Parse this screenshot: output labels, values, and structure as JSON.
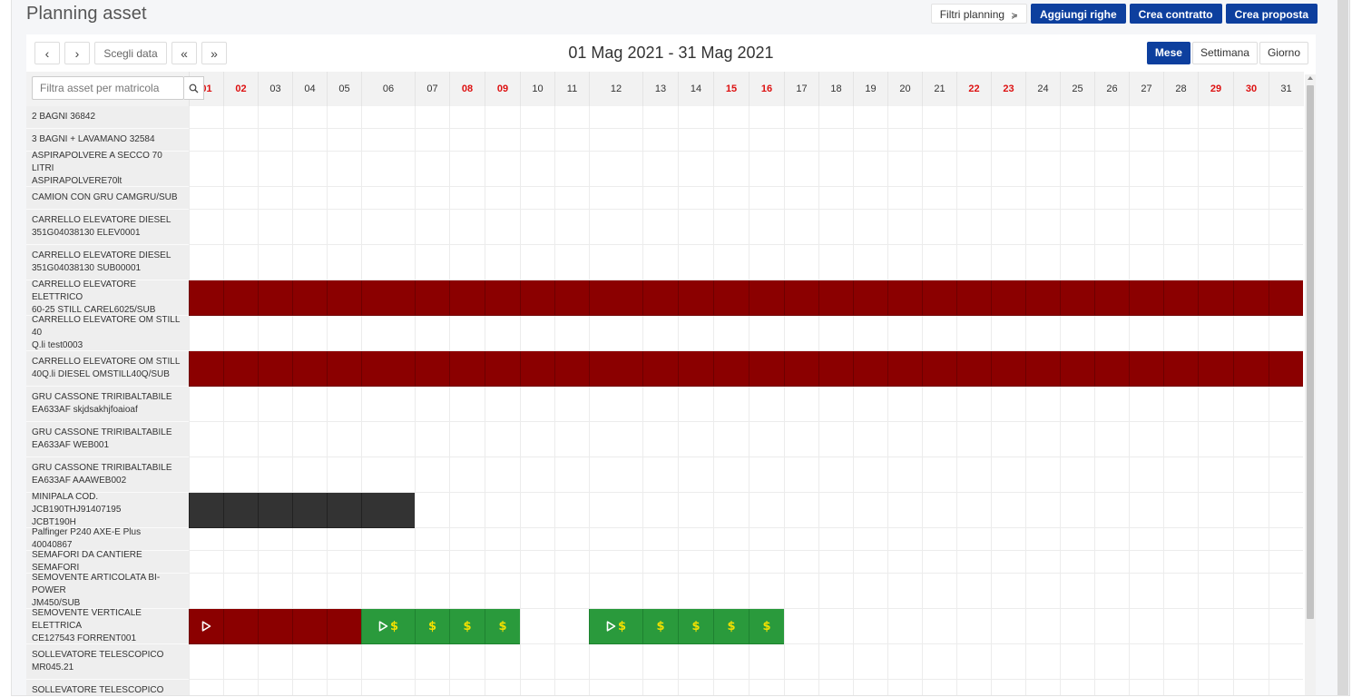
{
  "page": {
    "title": "Planning asset"
  },
  "top_actions": [
    {
      "name": "filter-planning-button",
      "label": "Filtri planning",
      "icon": "chevron-double-down-icon",
      "style": "default"
    },
    {
      "name": "add-rows-button",
      "label": "Aggiungi righe",
      "style": "primary"
    },
    {
      "name": "create-contract-button",
      "label": "Crea contratto",
      "style": "primary"
    },
    {
      "name": "create-proposal-button",
      "label": "Crea proposta",
      "style": "primary"
    }
  ],
  "toolbar": {
    "prev": "‹",
    "next": "›",
    "choose_date": "Scegli data",
    "fast_prev": "«",
    "fast_next": "»",
    "range_title": "01 Mag 2021 - 31 Mag 2021",
    "views": [
      "Mese",
      "Settimana",
      "Giorno"
    ],
    "active_view": "Mese"
  },
  "filter": {
    "placeholder": "Filtra asset per matricola",
    "icon": "search-icon"
  },
  "colors": {
    "primary": "#0d3f9e",
    "booked": "#8b0000",
    "blocked": "#333333",
    "contract": "#2a9a3c",
    "weekend_text": "#dd1111"
  },
  "days": [
    {
      "label": "01",
      "weekend": true
    },
    {
      "label": "02",
      "weekend": true
    },
    {
      "label": "03",
      "weekend": false
    },
    {
      "label": "04",
      "weekend": false
    },
    {
      "label": "05",
      "weekend": false
    },
    {
      "label": "06",
      "weekend": false
    },
    {
      "label": "07",
      "weekend": false
    },
    {
      "label": "08",
      "weekend": true
    },
    {
      "label": "09",
      "weekend": true
    },
    {
      "label": "10",
      "weekend": false
    },
    {
      "label": "11",
      "weekend": false
    },
    {
      "label": "12",
      "weekend": false
    },
    {
      "label": "13",
      "weekend": false
    },
    {
      "label": "14",
      "weekend": false
    },
    {
      "label": "15",
      "weekend": true
    },
    {
      "label": "16",
      "weekend": true
    },
    {
      "label": "17",
      "weekend": false
    },
    {
      "label": "18",
      "weekend": false
    },
    {
      "label": "19",
      "weekend": false
    },
    {
      "label": "20",
      "weekend": false
    },
    {
      "label": "21",
      "weekend": false
    },
    {
      "label": "22",
      "weekend": true
    },
    {
      "label": "23",
      "weekend": true
    },
    {
      "label": "24",
      "weekend": false
    },
    {
      "label": "25",
      "weekend": false
    },
    {
      "label": "26",
      "weekend": false
    },
    {
      "label": "27",
      "weekend": false
    },
    {
      "label": "28",
      "weekend": false
    },
    {
      "label": "29",
      "weekend": true
    },
    {
      "label": "30",
      "weekend": true
    },
    {
      "label": "31",
      "weekend": false
    }
  ],
  "assets": [
    {
      "label": [
        "2 BAGNI 36842"
      ],
      "bars": []
    },
    {
      "label": [
        "3 BAGNI + LAVAMANO 32584"
      ],
      "bars": []
    },
    {
      "label": [
        "ASPIRAPOLVERE A SECCO 70 LITRI",
        "ASPIRAPOLVERE70lt"
      ],
      "bars": []
    },
    {
      "label": [
        "CAMION CON GRU CAMGRU/SUB"
      ],
      "bars": []
    },
    {
      "label": [
        "CARRELLO ELEVATORE DIESEL",
        "351G04038130 ELEV0001"
      ],
      "bars": []
    },
    {
      "label": [
        "CARRELLO ELEVATORE DIESEL",
        "351G04038130 SUB00001"
      ],
      "bars": []
    },
    {
      "label": [
        "CARRELLO ELEVATORE ELETTRICO",
        "60-25 STILL CAREL6025/SUB"
      ],
      "bars": [
        {
          "from": 1,
          "to": 31,
          "status": "red"
        }
      ]
    },
    {
      "label": [
        "CARRELLO ELEVATORE OM STILL 40",
        "Q.li test0003"
      ],
      "bars": []
    },
    {
      "label": [
        "CARRELLO ELEVATORE OM STILL",
        "40Q.li DIESEL OMSTILL40Q/SUB"
      ],
      "bars": [
        {
          "from": 1,
          "to": 31,
          "status": "red"
        }
      ]
    },
    {
      "label": [
        "GRU CASSONE TRIRIBALTABILE",
        "EA633AF skjdsakhjfoaioaf"
      ],
      "bars": []
    },
    {
      "label": [
        "GRU CASSONE TRIRIBALTABILE",
        "EA633AF WEB001"
      ],
      "bars": []
    },
    {
      "label": [
        "GRU CASSONE TRIRIBALTABILE",
        "EA633AF AAAWEB002"
      ],
      "bars": []
    },
    {
      "label": [
        "MINIPALA COD. JCB190THJ91407195",
        "JCBT190H"
      ],
      "bars": [
        {
          "from": 1,
          "to": 6,
          "status": "dark"
        }
      ]
    },
    {
      "label": [
        "Palfinger P240 AXE-E Plus 40040867"
      ],
      "bars": []
    },
    {
      "label": [
        "SEMAFORI DA CANTIERE SEMAFORI"
      ],
      "bars": []
    },
    {
      "label": [
        "SEMOVENTE ARTICOLATA BI-POWER",
        "JM450/SUB"
      ],
      "bars": []
    },
    {
      "label": [
        "SEMOVENTE VERTICALE ELETTRICA",
        "CE127543 FORRENT001"
      ],
      "bars": [
        {
          "from": 1,
          "to": 5,
          "status": "red",
          "start_icon": "play-outline-icon"
        },
        {
          "from": 6,
          "to": 9,
          "status": "green",
          "start_icon": "play-outline-icon",
          "money": true
        },
        {
          "from": 12,
          "to": 16,
          "status": "green",
          "start_icon": "play-outline-icon",
          "money": true
        }
      ]
    },
    {
      "label": [
        "SOLLEVATORE TELESCOPICO",
        "MR045.21"
      ],
      "bars": []
    },
    {
      "label": [
        "SOLLEVATORE TELESCOPICO ROTO",
        ""
      ],
      "bars": []
    }
  ]
}
